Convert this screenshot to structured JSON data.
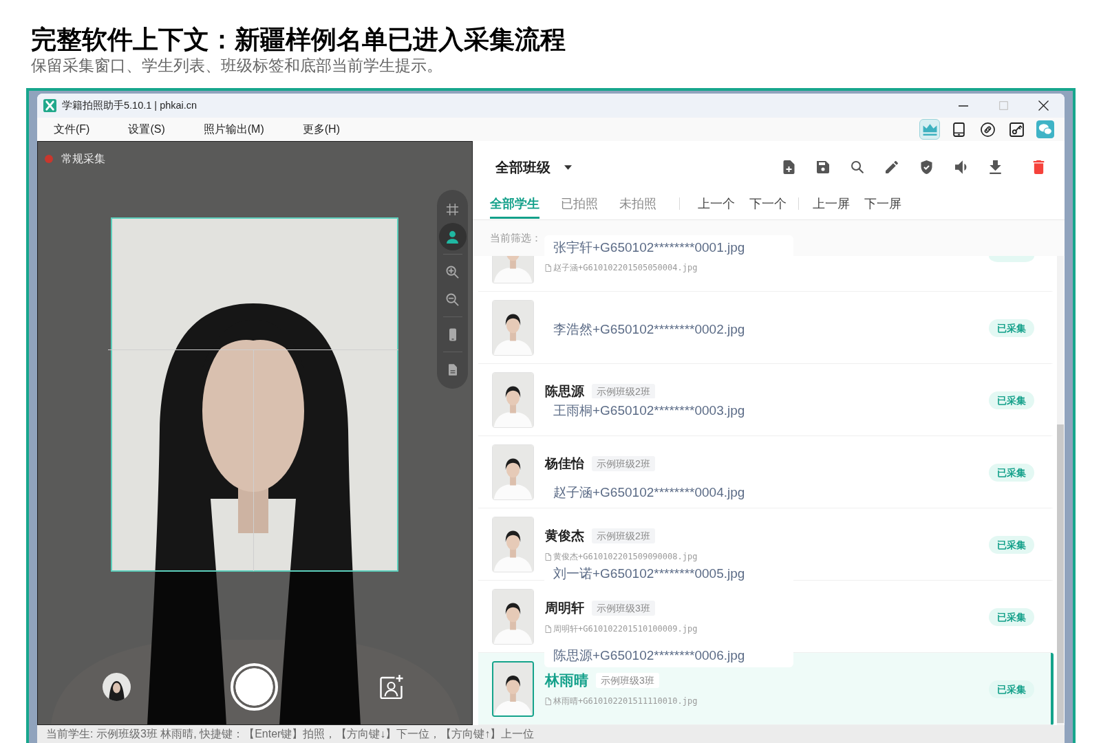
{
  "heading": {
    "title": "完整软件上下文：新疆样例名单已进入采集流程",
    "subtitle": "保留采集窗口、学生列表、班级标签和底部当前学生提示。"
  },
  "window": {
    "title": "学籍拍照助手5.10.1 | phkai.cn",
    "controls": [
      {
        "kind": "minimize",
        "disabled": false
      },
      {
        "kind": "maximize",
        "disabled": true
      },
      {
        "kind": "close",
        "disabled": false
      }
    ]
  },
  "menu": [
    "文件(F)",
    "设置(S)",
    "照片输出(M)",
    "更多(H)"
  ],
  "menu_tools": [
    {
      "kind": "crown",
      "active": true
    },
    {
      "kind": "tablet",
      "active": false
    },
    {
      "kind": "link",
      "active": false
    },
    {
      "kind": "key",
      "active": false
    },
    {
      "kind": "chat",
      "active": false
    }
  ],
  "camera": {
    "mode": {
      "label": "常规采集",
      "live": true
    },
    "tool_groups": [
      [
        {
          "kind": "grid",
          "active": false
        },
        {
          "kind": "person",
          "active": true
        }
      ],
      [
        {
          "kind": "zoom-in",
          "active": false
        },
        {
          "kind": "zoom-out",
          "active": false
        }
      ],
      [
        {
          "kind": "phone",
          "active": false
        }
      ],
      [
        {
          "kind": "document",
          "active": false
        }
      ]
    ]
  },
  "student_panel": {
    "class_filter": "全部班级",
    "actions": [
      {
        "kind": "add-file"
      },
      {
        "kind": "save"
      },
      {
        "kind": "search"
      },
      {
        "kind": "edit"
      },
      {
        "kind": "verify"
      },
      {
        "kind": "sound"
      },
      {
        "kind": "download"
      },
      {
        "kind": "delete"
      }
    ],
    "filter_tabs": [
      {
        "label": "全部学生",
        "selected": true
      },
      {
        "label": "已拍照",
        "selected": false
      },
      {
        "label": "未拍照",
        "selected": false
      }
    ],
    "nav_groups": [
      [
        "上一个",
        "下一个"
      ],
      [
        "上一屏",
        "下一屏"
      ]
    ],
    "filter_label": "当前筛选：",
    "students": [
      {
        "kind": "clipped",
        "filename": "赵子涵+G610102201505050004.jpg",
        "selected": false
      },
      {
        "kind": "full",
        "status": "已采集",
        "selected": false
      },
      {
        "kind": "full",
        "name": "陈思源",
        "class_tag": "示例班级2班",
        "status": "已采集",
        "selected": false
      },
      {
        "kind": "full",
        "name": "杨佳怡",
        "class_tag": "示例班级2班",
        "status": "已采集",
        "selected": false
      },
      {
        "kind": "full",
        "name": "黄俊杰",
        "class_tag": "示例班级2班",
        "filename": "黄俊杰+G610102201509090008.jpg",
        "status": "已采集",
        "selected": false
      },
      {
        "kind": "full",
        "name": "周明轩",
        "class_tag": "示例班级3班",
        "filename": "周明轩+G610102201510100009.jpg",
        "status": "已采集",
        "selected": false
      },
      {
        "kind": "full",
        "name": "林雨晴",
        "class_tag": "示例班级3班",
        "filename": "林雨晴+G610102201511110010.jpg",
        "status": "已采集",
        "selected": true
      }
    ],
    "filename_labels": [
      "张宇轩+G650102********0001.jpg",
      "李浩然+G650102********0002.jpg",
      "王雨桐+G650102********0003.jpg",
      "赵子涵+G650102********0004.jpg",
      "刘一诺+G650102********0005.jpg",
      "陈思源+G650102********0006.jpg"
    ]
  },
  "status_bar": "当前学生: 示例班级3班 林雨晴, 快捷键：【Enter键】拍照，【方向键↓】下一位，【方向键↑】上一位"
}
